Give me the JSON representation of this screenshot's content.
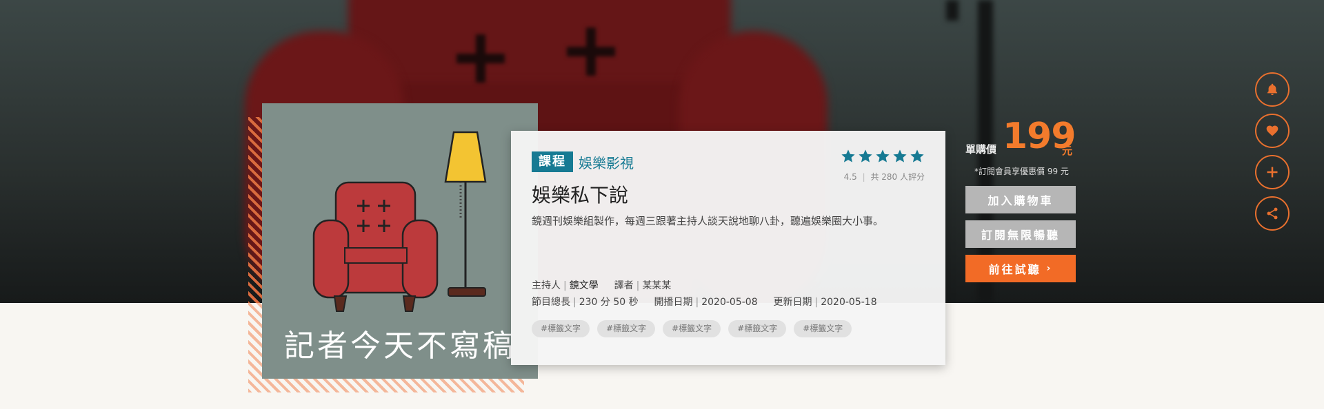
{
  "cover": {
    "title": "記者今天不寫稿"
  },
  "card": {
    "badge": "課程",
    "category": "娛樂影視",
    "title": "娛樂私下說",
    "description": "鏡週刊娛樂組製作，每週三跟著主持人談天說地聊八卦，聽遍娛樂圈大小事。",
    "rating": {
      "stars": 5,
      "score": "4.5",
      "count_text": "共 280 人評分"
    },
    "meta": {
      "host_label": "主持人",
      "host": "鏡文學",
      "narrator_label": "譯者",
      "narrator": "某某某",
      "duration_label": "節目總長",
      "duration": "230 分 50 秒",
      "start_label": "開播日期",
      "start_date": "2020-05-08",
      "update_label": "更新日期",
      "update_date": "2020-05-18"
    },
    "tags": [
      "#標籤文字",
      "#標籤文字",
      "#標籤文字",
      "#標籤文字",
      "#標籤文字"
    ]
  },
  "purchase": {
    "price_label": "單購價",
    "price": "199",
    "unit": "元",
    "member_note": "*訂閱會員享優惠價 99 元",
    "add_cart": "加入購物車",
    "subscribe": "訂閱無限暢聽",
    "trial": "前往試聽",
    "trial_icon": "chevron-right-icon"
  },
  "actions": [
    "bell-icon",
    "heart-icon",
    "plus-icon",
    "share-icon"
  ],
  "colors": {
    "accent": "#f26b26",
    "course_blue": "#167a93",
    "button_grey": "#b6b6b6"
  }
}
